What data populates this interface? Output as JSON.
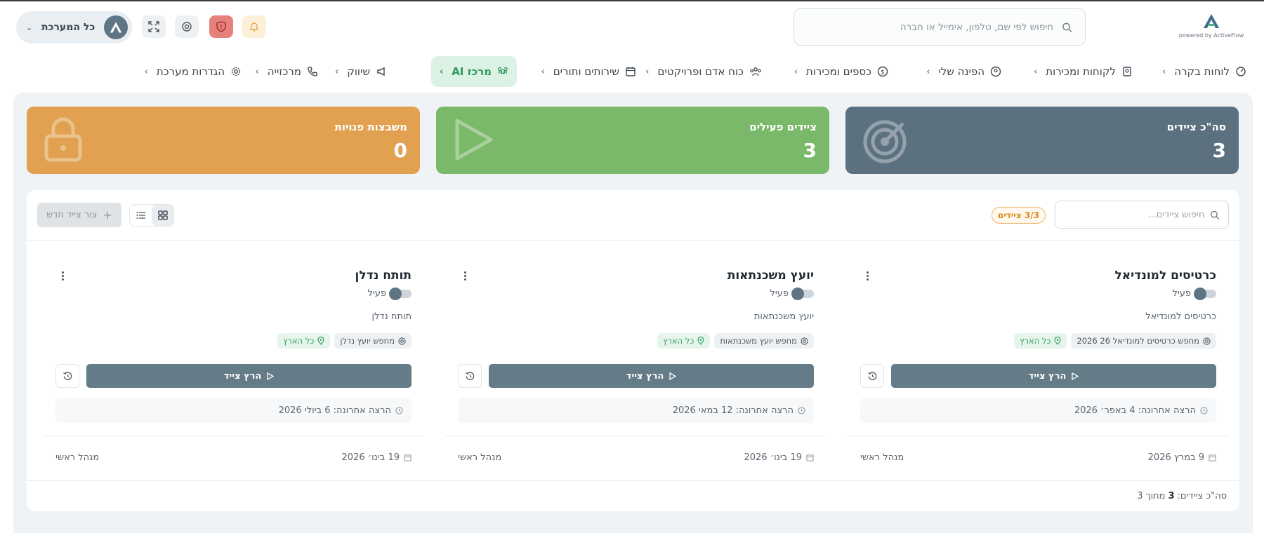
{
  "header": {
    "brand_caption": "powered by ActiveFlow",
    "search_placeholder": "חיפוש לפי שם, טלפון, אימייל או חברה",
    "system_selector": "כל המערכת"
  },
  "nav": {
    "items": [
      {
        "label": "לוחות בקרה",
        "icon": "dashboard-icon"
      },
      {
        "label": "לקוחות ומכירות",
        "icon": "contacts-icon"
      },
      {
        "label": "הפינה שלי",
        "icon": "user-circle-icon"
      },
      {
        "label": "כספים ומכירות",
        "icon": "dollar-icon"
      },
      {
        "label": "כוח אדם ופרויקטים",
        "icon": "team-icon"
      },
      {
        "label": "שירותים ותורים",
        "icon": "calendar-icon"
      },
      {
        "label": "מרכז AI",
        "icon": "command-icon",
        "active": true
      },
      {
        "label": "שיווק",
        "icon": "megaphone-icon"
      },
      {
        "label": "מרכזייה",
        "icon": "phone-icon"
      },
      {
        "label": "הגדרות מערכת",
        "icon": "gear-icon"
      }
    ]
  },
  "stats": {
    "total": {
      "label": "סה\"כ ציידים",
      "value": "3"
    },
    "active": {
      "label": "ציידים פעילים",
      "value": "3"
    },
    "vacant": {
      "label": "משבצות פנויות",
      "value": "0"
    }
  },
  "toolbar": {
    "search_placeholder": "חיפוש ציידים...",
    "count_badge": "3/3 ציידים",
    "new_agent_label": "צור צייד חדש"
  },
  "agents": [
    {
      "title": "כרטיסים למונדיאל",
      "status": "פעיל",
      "description": "כרטיסים למונדיאל",
      "tags": [
        "מחפש כרטיסים למונדיאל 26 2026",
        "כל הארץ"
      ],
      "run_label": "הרץ צייד",
      "last_run": "הרצה אחרונה: 4 באפר׳ 2026",
      "created": "9 במרץ 2026",
      "owner": "מנהל ראשי"
    },
    {
      "title": "יועץ משכנתאות",
      "status": "פעיל",
      "description": "יועץ משכנתאות",
      "tags": [
        "מחפש יועץ משכנתאות",
        "כל הארץ"
      ],
      "run_label": "הרץ צייד",
      "last_run": "הרצה אחרונה: 12 במאי 2026",
      "created": "19 בינו׳ 2026",
      "owner": "מנהל ראשי"
    },
    {
      "title": "תותח נדלן",
      "status": "פעיל",
      "description": "תותח נדלן",
      "tags": [
        "מחפש יועץ נדלן",
        "כל הארץ"
      ],
      "run_label": "הרץ צייד",
      "last_run": "הרצה אחרונה: 6 ביולי 2026",
      "created": "19 בינו׳ 2026",
      "owner": "מנהל ראשי"
    }
  ],
  "footer": {
    "prefix": "סה\"כ ציידים:",
    "shown": "3",
    "suffix": "מתוך 3"
  },
  "colors": {
    "stat_total": "#5c717f",
    "stat_active": "#7ab969",
    "stat_vacant": "#e1a150",
    "nav_active": "#2f9a5d",
    "run_button": "#647b88"
  }
}
